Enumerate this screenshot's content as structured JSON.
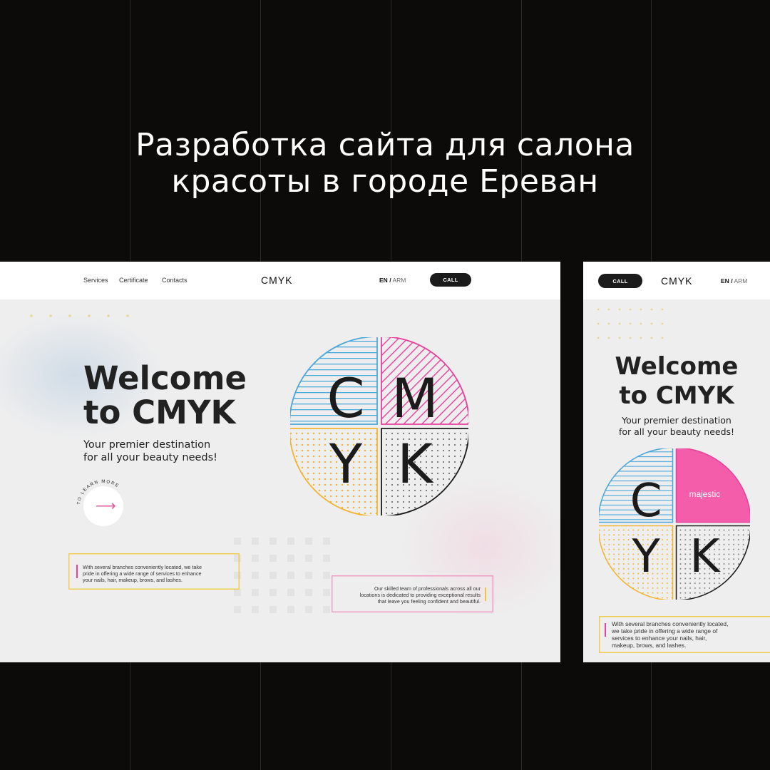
{
  "headline": {
    "line1": "Разработка сайта для салона",
    "line2": "красоты в городе Ереван"
  },
  "desktop": {
    "nav": {
      "links": [
        "Services",
        "Certificate",
        "Contacts"
      ],
      "logo": "CMYK",
      "lang_active": "EN",
      "lang_sep": "/",
      "lang_other": "ARM",
      "call": "CALL"
    },
    "hero": {
      "title_line1": "Welcome",
      "title_line2": "to CMYK",
      "subtitle_line1": "Your premier destination",
      "subtitle_line2": "for all your beauty needs!",
      "learn_more": "TO LEARN MORE"
    },
    "note_left": {
      "line1": "With several branches conveniently located, we take",
      "line2": "pride in offering a wide range of services to enhance",
      "line3": "your nails, hair, makeup, brows, and lashes."
    },
    "note_right": {
      "line1": "Our skilled team of professionals across all our",
      "line2": "locations is dedicated to providing exceptional results",
      "line3": "that leave you feeling confident and beautiful."
    }
  },
  "mobile": {
    "nav": {
      "call": "CALL",
      "logo": "CMYK",
      "lang_active": "EN",
      "lang_sep": "/",
      "lang_other": "ARM"
    },
    "hero": {
      "title_line1": "Welcome",
      "title_line2": "to CMYK",
      "subtitle_line1": "Your premier destination",
      "subtitle_line2": "for all your beauty needs!",
      "magenta_label": "majestic"
    },
    "note": {
      "line1": "With several branches conveniently located,",
      "line2": "we take pride in offering a wide range of",
      "line3": "services to enhance your nails, hair,",
      "line4": "makeup, brows, and lashes."
    }
  },
  "logo_letters": {
    "c": "C",
    "m": "M",
    "y": "Y",
    "k": "K"
  },
  "colors": {
    "cyan": "#4aa8dc",
    "magenta": "#e6419c",
    "magenta_fill": "#f35da9",
    "yellow": "#f2b430",
    "black": "#1b1b1b",
    "yellow_accent": "#f0c73c",
    "pink_accent": "#f08fbd"
  }
}
